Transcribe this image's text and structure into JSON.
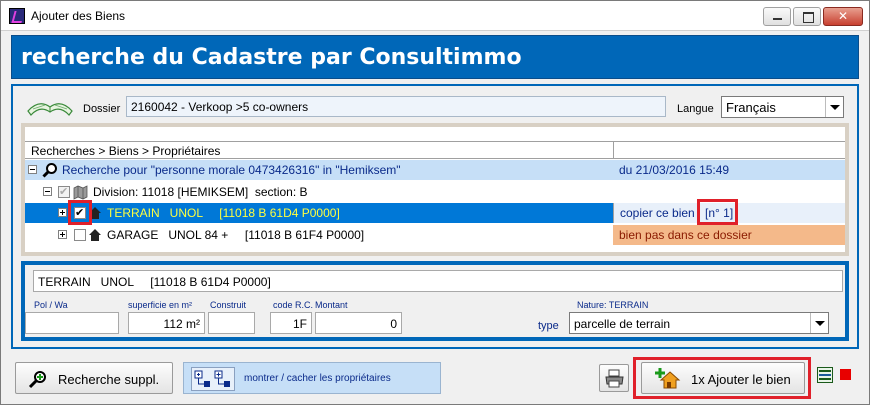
{
  "window": {
    "title": "Ajouter des Biens"
  },
  "header": {
    "title": "recherche du Cadastre par Consultimmo"
  },
  "dossier": {
    "label": "Dossier",
    "value": "2160042 - Verkoop >5 co-owners"
  },
  "langue": {
    "label": "Langue",
    "value": "Français"
  },
  "tree": {
    "header": "Recherches > Biens > Propriétaires",
    "rows": [
      {
        "text": "Recherche pour \"personne morale 0473426316\" in \"Hemiksem\"",
        "right": "du 21/03/2016 15:49"
      },
      {
        "text": "Division: 11018 [HEMIKSEM]  section: B",
        "right": ""
      },
      {
        "text": "TERRAIN   UNOL     [11018 B 61D4 P0000]",
        "right": "copier ce bien",
        "right_extra": "[n° 1]"
      },
      {
        "text": "GARAGE   UNOL 84 +     [11018 B 61F4 P0000]",
        "right": "bien pas dans ce dossier"
      }
    ]
  },
  "detail": {
    "description": "TERRAIN   UNOL     [11018 B 61D4 P0000]",
    "labels": {
      "pol_wa": "Pol / Wa",
      "superficie": "superficie en m²",
      "construit": "Construit",
      "code_rc": "code R.C.",
      "montant": "Montant",
      "nature": "Nature: TERRAIN",
      "type": "type"
    },
    "values": {
      "pol_wa": "",
      "superficie": "112 m²",
      "construit": "",
      "code_rc": "1F",
      "montant": "0",
      "type": "parcelle de terrain"
    }
  },
  "footer": {
    "search_button": "Recherche suppl.",
    "toggle_label": "montrer / cacher les propriétaires",
    "add_button": "1x Ajouter le bien"
  },
  "colors": {
    "accent": "#0067b8",
    "highlight_red": "#e0202a",
    "warning_bg": "#f4b98a"
  }
}
